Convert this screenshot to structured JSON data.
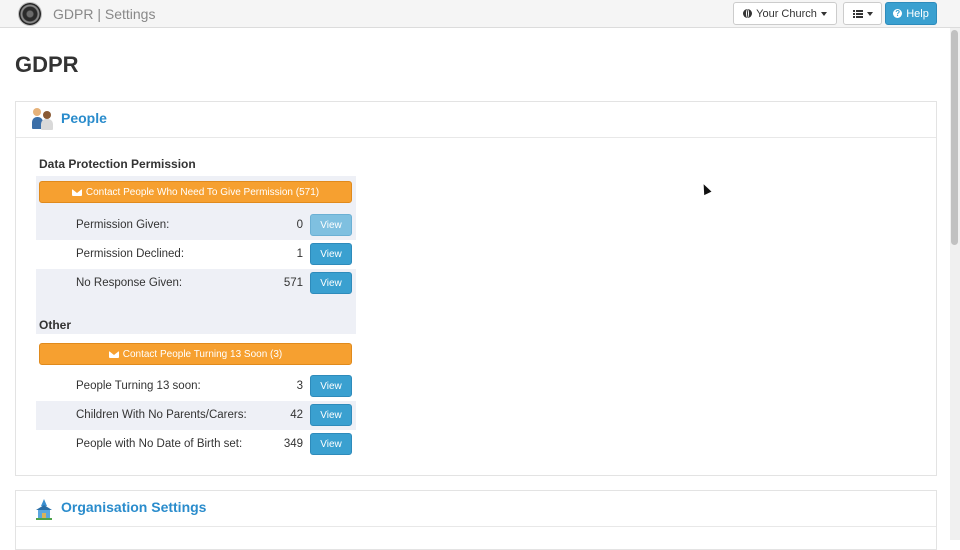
{
  "navbar": {
    "app_title": "GDPR | Settings",
    "church_label": "Your Church",
    "help_label": "Help"
  },
  "page": {
    "title": "GDPR"
  },
  "people_panel": {
    "title": "People",
    "data_protection": {
      "heading": "Data Protection Permission",
      "contact_button": "Contact People Who Need To Give Permission (571)",
      "rows": [
        {
          "label": "Permission Given:",
          "count": "0",
          "action": "View"
        },
        {
          "label": "Permission Declined:",
          "count": "1",
          "action": "View"
        },
        {
          "label": "No Response Given:",
          "count": "571",
          "action": "View"
        }
      ]
    },
    "other": {
      "heading": "Other",
      "contact_button": "Contact People Turning 13 Soon (3)",
      "rows": [
        {
          "label": "People Turning 13 soon:",
          "count": "3",
          "action": "View"
        },
        {
          "label": "Children With No Parents/Carers:",
          "count": "42",
          "action": "View"
        },
        {
          "label": "People with No Date of Birth set:",
          "count": "349",
          "action": "View"
        }
      ]
    }
  },
  "org_panel": {
    "title": "Organisation Settings"
  },
  "colors": {
    "brand_blue": "#2a8ccc",
    "button_blue": "#3aa0d0",
    "orange": "#f6a030"
  }
}
